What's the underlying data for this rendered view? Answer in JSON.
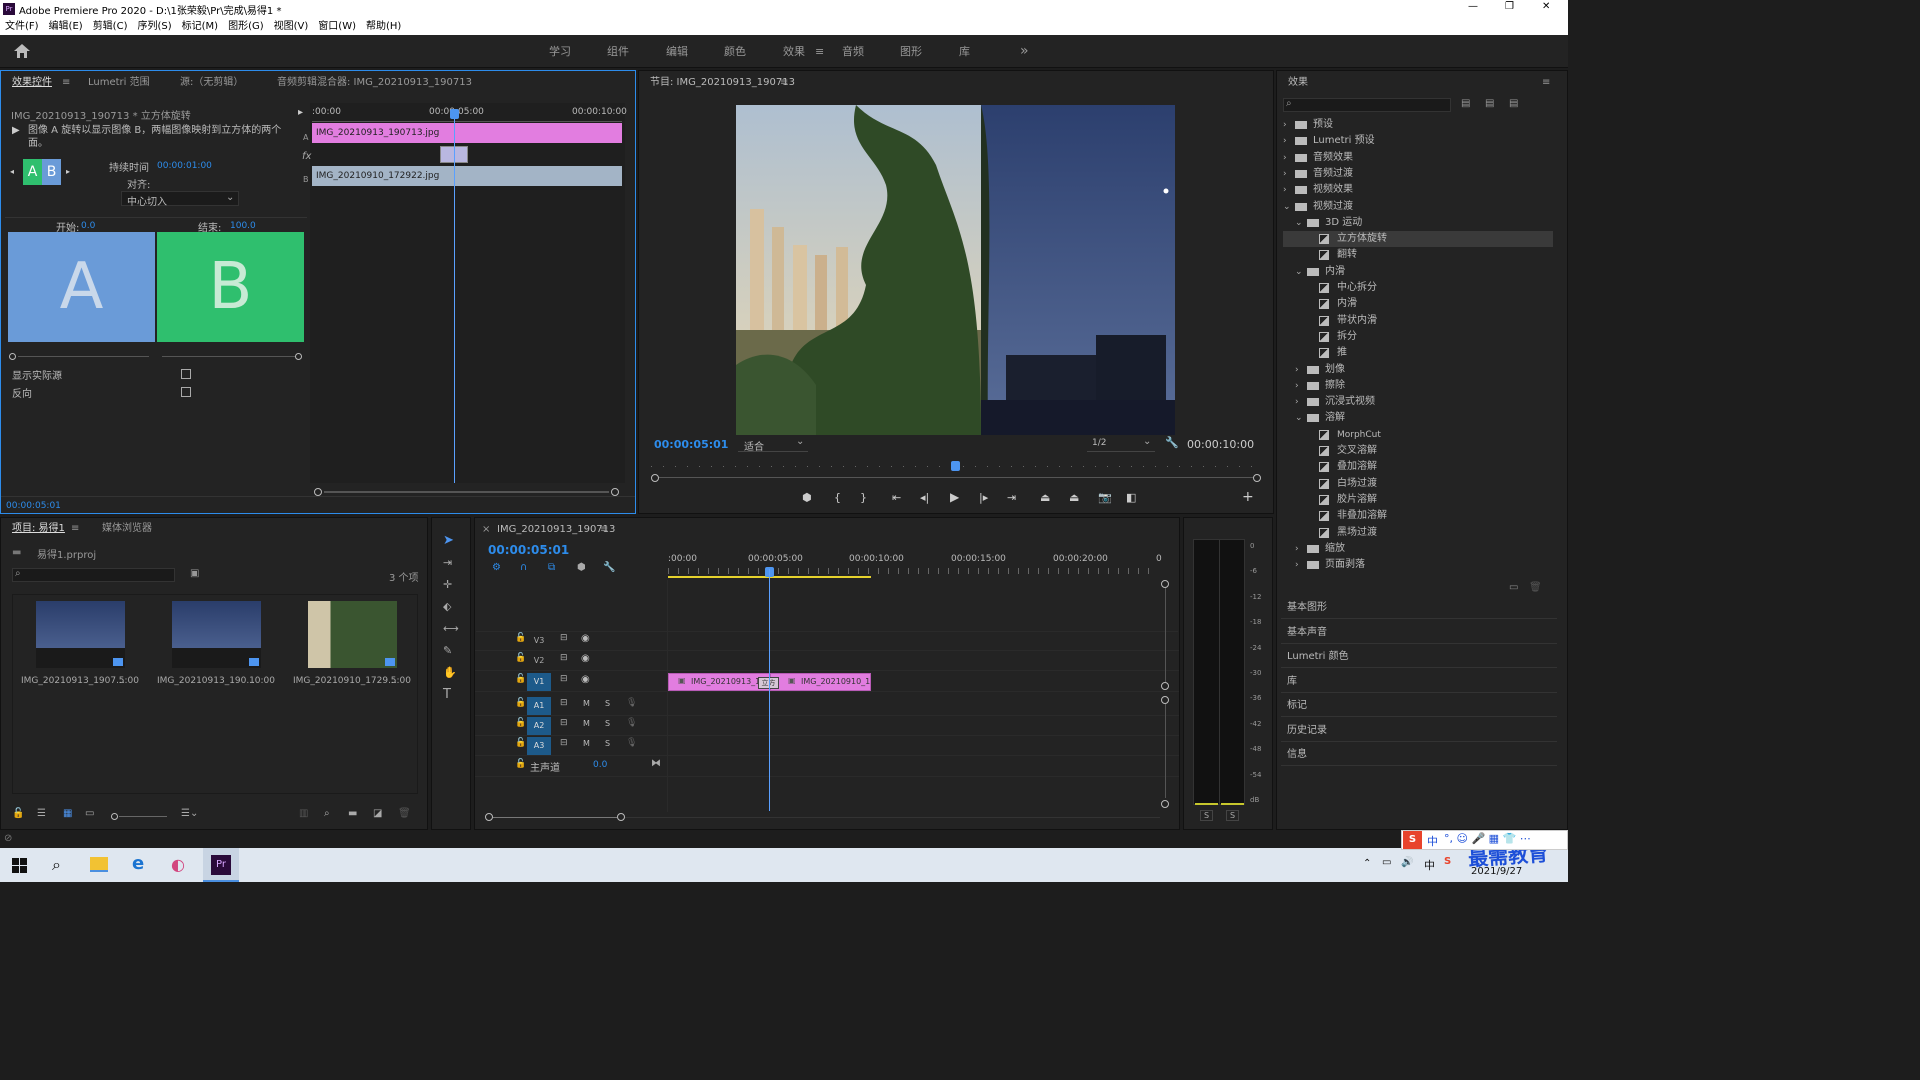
{
  "window": {
    "title": "Adobe Premiere Pro 2020 - D:\\1张荣毅\\Pr\\完成\\易得1 *",
    "minimize": "—",
    "maximize": "❐",
    "close": "✕"
  },
  "menu": [
    "文件(F)",
    "编辑(E)",
    "剪辑(C)",
    "序列(S)",
    "标记(M)",
    "图形(G)",
    "视图(V)",
    "窗口(W)",
    "帮助(H)"
  ],
  "workspaces": [
    "学习",
    "组件",
    "编辑",
    "颜色",
    "效果",
    "音频",
    "图形",
    "库"
  ],
  "workspace_active": "效果",
  "workspace_more": "»",
  "effect_controls": {
    "tabs": [
      "效果控件",
      "Lumetri 范围",
      "源:（无剪辑）",
      "音频剪辑混合器: IMG_20210913_190713"
    ],
    "clip_path": "IMG_20210913_190713 * 立方体旋转",
    "description": "图像 A 旋转以显示图像 B，两幅图像映射到立方体的两个面。",
    "thumb_a": "A",
    "thumb_b": "B",
    "duration_label": "持续时间",
    "duration_value": "00:00:01:00",
    "align_label": "对齐:",
    "align_value": "中心切入",
    "start_label": "开始:",
    "start_value": "0.0",
    "end_label": "结束:",
    "end_value": "100.0",
    "big_a": "A",
    "big_b": "B",
    "show_source_label": "显示实际源",
    "reverse_label": "反向",
    "timecode": "00:00:05:01",
    "ruler": [
      ":00:00",
      "00:00:05:00",
      "00:00:10:00"
    ],
    "clip_a": "IMG_20210913_190713.jpg",
    "clip_b": "IMG_20210910_172922.jpg",
    "track_a": "A",
    "track_b": "B",
    "fx": "fx"
  },
  "program_monitor": {
    "title": "节目: IMG_20210913_190713",
    "timecode": "00:00:05:01",
    "fit": "适合",
    "resolution": "1/2",
    "duration": "00:00:10:00",
    "playhead_fraction": 0.5
  },
  "effects_panel": {
    "title": "效果",
    "tree": [
      {
        "label": "预设",
        "level": 0,
        "type": "folder",
        "open": false
      },
      {
        "label": "Lumetri 预设",
        "level": 0,
        "type": "folder",
        "open": false
      },
      {
        "label": "音频效果",
        "level": 0,
        "type": "folder",
        "open": false
      },
      {
        "label": "音频过渡",
        "level": 0,
        "type": "folder",
        "open": false
      },
      {
        "label": "视频效果",
        "level": 0,
        "type": "folder",
        "open": false
      },
      {
        "label": "视频过渡",
        "level": 0,
        "type": "folder",
        "open": true
      },
      {
        "label": "3D 运动",
        "level": 1,
        "type": "folder",
        "open": true
      },
      {
        "label": "立方体旋转",
        "level": 2,
        "type": "item",
        "selected": true
      },
      {
        "label": "翻转",
        "level": 2,
        "type": "item"
      },
      {
        "label": "内滑",
        "level": 1,
        "type": "folder",
        "open": true
      },
      {
        "label": "中心拆分",
        "level": 2,
        "type": "item"
      },
      {
        "label": "内滑",
        "level": 2,
        "type": "item"
      },
      {
        "label": "带状内滑",
        "level": 2,
        "type": "item"
      },
      {
        "label": "拆分",
        "level": 2,
        "type": "item"
      },
      {
        "label": "推",
        "level": 2,
        "type": "item"
      },
      {
        "label": "划像",
        "level": 1,
        "type": "folder",
        "open": false
      },
      {
        "label": "擦除",
        "level": 1,
        "type": "folder",
        "open": false
      },
      {
        "label": "沉浸式视频",
        "level": 1,
        "type": "folder",
        "open": false
      },
      {
        "label": "溶解",
        "level": 1,
        "type": "folder",
        "open": true
      },
      {
        "label": "MorphCut",
        "level": 2,
        "type": "item"
      },
      {
        "label": "交叉溶解",
        "level": 2,
        "type": "item"
      },
      {
        "label": "叠加溶解",
        "level": 2,
        "type": "item"
      },
      {
        "label": "白场过渡",
        "level": 2,
        "type": "item"
      },
      {
        "label": "胶片溶解",
        "level": 2,
        "type": "item"
      },
      {
        "label": "非叠加溶解",
        "level": 2,
        "type": "item"
      },
      {
        "label": "黑场过渡",
        "level": 2,
        "type": "item"
      },
      {
        "label": "缩放",
        "level": 1,
        "type": "folder",
        "open": false
      },
      {
        "label": "页面剥落",
        "level": 1,
        "type": "folder",
        "open": false
      }
    ],
    "sections": [
      "基本图形",
      "基本声音",
      "Lumetri 颜色",
      "库",
      "标记",
      "历史记录",
      "信息"
    ]
  },
  "project_panel": {
    "tabs": [
      "项目: 易得1",
      "媒体浏览器"
    ],
    "file": "易得1.prproj",
    "count": "3 个项",
    "items": [
      {
        "name": "IMG_20210913_1907...",
        "duration": "5:00"
      },
      {
        "name": "IMG_20210913_190...",
        "duration": "10:00"
      },
      {
        "name": "IMG_20210910_1729...",
        "duration": "5:00"
      }
    ]
  },
  "timeline": {
    "title": "IMG_20210913_190713",
    "timecode": "00:00:05:01",
    "ruler": [
      ":00:00",
      "00:00:05:00",
      "00:00:10:00",
      "00:00:15:00",
      "00:00:20:00",
      "0"
    ],
    "tracks": [
      {
        "name": "V3",
        "type": "video"
      },
      {
        "name": "V2",
        "type": "video"
      },
      {
        "name": "V1",
        "type": "video"
      },
      {
        "name": "A1",
        "type": "audio"
      },
      {
        "name": "A2",
        "type": "audio"
      },
      {
        "name": "A3",
        "type": "audio"
      }
    ],
    "master": "主声道",
    "master_value": "0.0",
    "clip1": "IMG_20210913_19",
    "clip2": "IMG_20210910_172",
    "transition": "立方"
  },
  "meter": {
    "ticks": [
      "0",
      "-6",
      "-12",
      "-18",
      "-24",
      "-30",
      "-36",
      "-42",
      "-48",
      "-54",
      "dB"
    ],
    "solo": [
      "S",
      "S"
    ]
  },
  "taskbar": {
    "date": "2021/9/27",
    "ime": "中",
    "watermark": "最需教育"
  }
}
